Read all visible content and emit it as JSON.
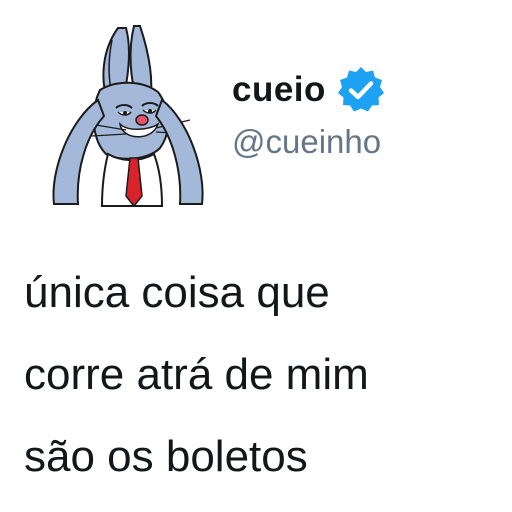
{
  "tweet": {
    "author": {
      "display_name": "cueio",
      "handle": "@cueinho",
      "verified": true,
      "avatar_icon": "bugs-bunny-avatar-icon",
      "badge_icon": "verified-badge-icon"
    },
    "text_lines": [
      "única coisa que",
      "corre atrá de mim",
      "são os boletos"
    ]
  },
  "colors": {
    "verified_blue": "#1da1f2",
    "handle_gray": "#657786",
    "text": "#14171a",
    "bunny_fur": "#a4b9d9",
    "nose": "#e8506b",
    "tie": "#d8232a"
  }
}
